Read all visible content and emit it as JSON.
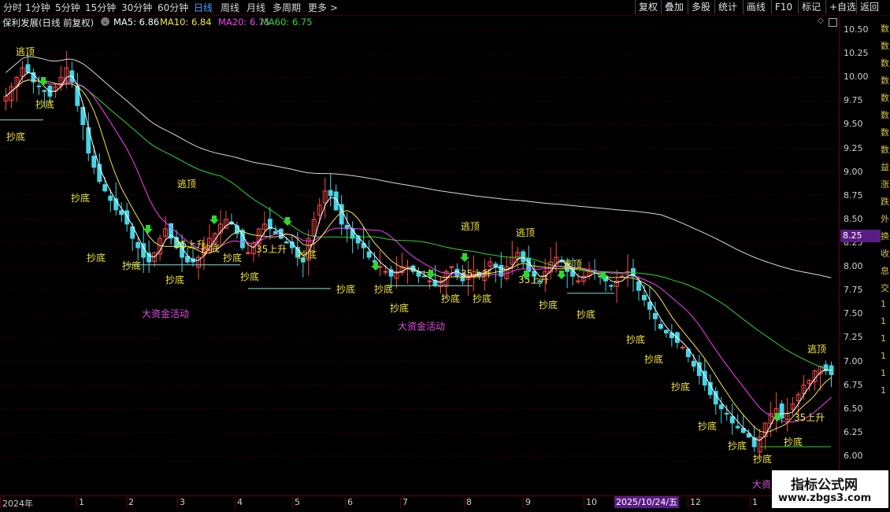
{
  "toolbar": {
    "periods": [
      "分时",
      "1分钟",
      "5分钟",
      "15分钟",
      "30分钟",
      "60分钟",
      "日线",
      "周线",
      "月线",
      "多周期",
      "更多 >"
    ],
    "active_period": "日线",
    "tools": [
      "复权",
      "叠加",
      "多股",
      "统计",
      "画线",
      "F10",
      "标记",
      "+自选",
      "返回"
    ]
  },
  "stock": {
    "title": "保利发展(日线 前复权)",
    "ma5_label": "MA5: 6.86",
    "ma10_label": "MA10: 6.84",
    "ma20_label": "MA20: 6.75",
    "ma60_label": "MA60: 6.75"
  },
  "colors": {
    "up": "#ff4a4a",
    "down": "#45d6e6",
    "ma5": "#ffffff",
    "ma10": "#f5e642",
    "ma20": "#ff3dff",
    "ma60": "#2fd82f",
    "long_ma": "#d8d8d8",
    "signal_text": "#f3ea3a",
    "big_money_text": "#e050e0"
  },
  "price_axis": {
    "ticks": [
      "10.50",
      "10.25",
      "10.00",
      "9.75",
      "9.50",
      "9.25",
      "9.00",
      "8.75",
      "8.50",
      "8.25",
      "8.00",
      "7.75",
      "7.50",
      "7.25",
      "7.00",
      "6.75",
      "6.50",
      "6.25",
      "6.00"
    ],
    "current_price": "8.25"
  },
  "date_axis": {
    "labels": [
      "2024年",
      "1",
      "2",
      "3",
      "4",
      "5",
      "6",
      "7",
      "8",
      "9",
      "10",
      "12",
      "1"
    ],
    "current_date": "2025/10/24/五"
  },
  "right_strip": [
    "数",
    "数",
    "数",
    "数",
    "数",
    "数",
    "数",
    "数",
    "益",
    "涨",
    "跌",
    "外",
    "换",
    "收",
    "息",
    "交",
    "1",
    "1",
    "1",
    "1",
    "1",
    "1"
  ],
  "signals": {
    "escape_top": "逃顶",
    "bottom_buy": "抄底",
    "rise_35": "35上升",
    "big_money": "大资金活动",
    "escape_positions": [
      [
        20,
        50
      ],
      [
        225,
        218
      ],
      [
        585,
        272
      ],
      [
        655,
        280
      ],
      [
        715,
        320
      ],
      [
        1025,
        428
      ]
    ],
    "bottom_positions": [
      [
        45,
        117
      ],
      [
        8,
        158
      ],
      [
        90,
        236
      ],
      [
        110,
        312
      ],
      [
        155,
        322
      ],
      [
        210,
        340
      ],
      [
        255,
        300
      ],
      [
        283,
        312
      ],
      [
        305,
        336
      ],
      [
        378,
        308
      ],
      [
        427,
        352
      ],
      [
        475,
        352
      ],
      [
        495,
        376
      ],
      [
        560,
        364
      ],
      [
        600,
        364
      ],
      [
        684,
        372
      ],
      [
        732,
        384
      ],
      [
        795,
        416
      ],
      [
        818,
        441
      ],
      [
        852,
        476
      ],
      [
        886,
        526
      ],
      [
        924,
        551
      ],
      [
        956,
        568
      ],
      [
        995,
        546
      ]
    ],
    "rise35_positions": [
      [
        222,
        295
      ],
      [
        325,
        301
      ],
      [
        585,
        332
      ],
      [
        658,
        340
      ],
      [
        1008,
        515
      ]
    ],
    "big_money_positions": [
      [
        180,
        383
      ],
      [
        505,
        399
      ],
      [
        955,
        600
      ]
    ]
  },
  "chart_data": {
    "type": "candlestick",
    "y_range": [
      6.0,
      10.5
    ],
    "close_series": [
      9.8,
      9.9,
      10.0,
      10.1,
      10.05,
      9.95,
      9.9,
      9.85,
      9.8,
      9.9,
      10.0,
      10.1,
      9.95,
      9.7,
      9.5,
      9.2,
      9.05,
      8.9,
      8.8,
      8.7,
      8.6,
      8.55,
      8.45,
      8.3,
      8.2,
      8.1,
      8.05,
      8.15,
      8.3,
      8.4,
      8.3,
      8.2,
      8.1,
      8.05,
      8.05,
      8.1,
      8.2,
      8.3,
      8.35,
      8.45,
      8.5,
      8.45,
      8.35,
      8.2,
      8.15,
      8.25,
      8.4,
      8.45,
      8.4,
      8.35,
      8.3,
      8.25,
      8.2,
      8.1,
      8.05,
      8.3,
      8.5,
      8.65,
      8.8,
      8.75,
      8.6,
      8.45,
      8.4,
      8.3,
      8.25,
      8.2,
      8.1,
      8.05,
      8.0,
      7.95,
      7.9,
      7.95,
      8.0,
      8.0,
      7.95,
      7.9,
      7.9,
      7.85,
      7.8,
      7.85,
      7.95,
      8.0,
      7.9,
      7.85,
      7.9,
      7.95,
      7.9,
      7.95,
      8.05,
      8.0,
      7.9,
      8.0,
      8.1,
      8.15,
      8.05,
      7.95,
      7.9,
      7.85,
      7.95,
      8.05,
      8.1,
      8.05,
      7.95,
      7.9,
      7.85,
      7.9,
      7.95,
      7.95,
      7.9,
      7.85,
      7.8,
      7.85,
      7.9,
      7.95,
      7.9,
      7.75,
      7.65,
      7.55,
      7.45,
      7.35,
      7.3,
      7.25,
      7.2,
      7.15,
      7.05,
      6.95,
      6.85,
      6.75,
      6.65,
      6.55,
      6.5,
      6.45,
      6.35,
      6.3,
      6.25,
      6.2,
      6.1,
      6.2,
      6.35,
      6.45,
      6.5,
      6.4,
      6.45,
      6.55,
      6.65,
      6.75,
      6.8,
      6.9,
      6.95,
      6.9,
      6.86
    ],
    "bottom_line_segments": [
      {
        "y": 9.55,
        "x0": 0,
        "x1": 55
      },
      {
        "y": 8.02,
        "x0": 160,
        "x1": 305
      },
      {
        "y": 7.77,
        "x0": 315,
        "x1": 420
      },
      {
        "y": 7.8,
        "x0": 490,
        "x1": 600
      },
      {
        "y": 7.72,
        "x0": 720,
        "x1": 780
      },
      {
        "y": 6.1,
        "x0": 965,
        "x1": 1055
      }
    ]
  }
}
